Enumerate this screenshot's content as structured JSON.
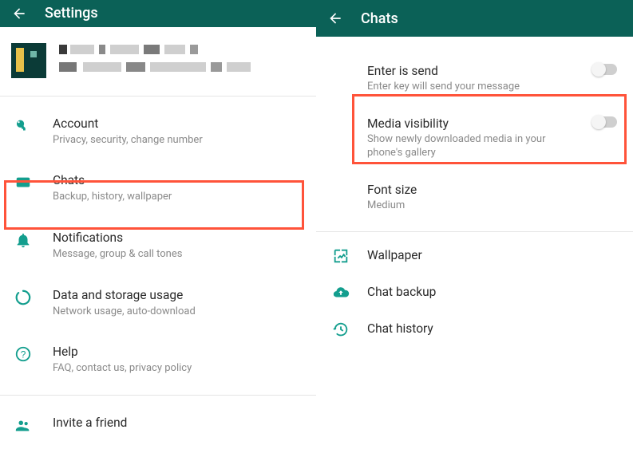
{
  "left": {
    "title": "Settings",
    "items": {
      "account": {
        "title": "Account",
        "sub": "Privacy, security, change number"
      },
      "chats": {
        "title": "Chats",
        "sub": "Backup, history, wallpaper"
      },
      "notifications": {
        "title": "Notifications",
        "sub": "Message, group & call tones"
      },
      "data": {
        "title": "Data and storage usage",
        "sub": "Network usage, auto-download"
      },
      "help": {
        "title": "Help",
        "sub": "FAQ, contact us, privacy policy"
      },
      "invite": {
        "title": "Invite a friend"
      }
    }
  },
  "right": {
    "title": "Chats",
    "enter": {
      "title": "Enter is send",
      "sub": "Enter key will send your message"
    },
    "media": {
      "title": "Media visibility",
      "sub": "Show newly downloaded media in your phone's gallery"
    },
    "font": {
      "title": "Font size",
      "sub": "Medium"
    },
    "wallpaper": "Wallpaper",
    "backup": "Chat backup",
    "history": "Chat history"
  }
}
